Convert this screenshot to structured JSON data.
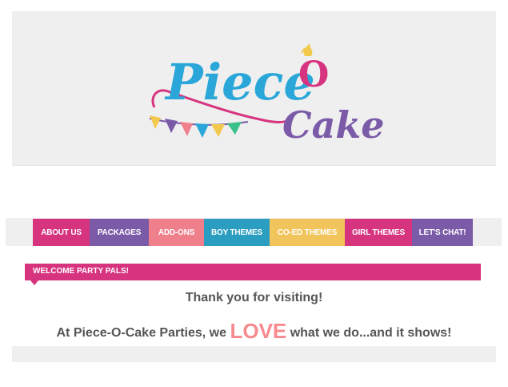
{
  "logo": {
    "line1": "Piece",
    "line1b": "O",
    "line2": "Cake"
  },
  "colors": {
    "brand_blue": "#2aa7d8",
    "brand_purple": "#7b5ba8",
    "brand_pink": "#d6347f",
    "accent_yellow": "#f2c94c",
    "love_coral": "#f78a8f"
  },
  "nav": {
    "items": [
      {
        "label": "ABOUT US",
        "color": "#d6347f"
      },
      {
        "label": "PACKAGES",
        "color": "#7b5ba8"
      },
      {
        "label": "ADD-ONS",
        "color": "#f07f8c"
      },
      {
        "label": "BOY THEMES",
        "color": "#2a9dc0"
      },
      {
        "label": "CO-ED THEMES",
        "color": "#f2c55c"
      },
      {
        "label": "GIRL THEMES",
        "color": "#d6347f"
      },
      {
        "label": "LET'S CHAT!",
        "color": "#7b5ba8"
      }
    ]
  },
  "welcome": {
    "heading": "WELCOME PARTY PALS!"
  },
  "content": {
    "thanks": "Thank you for visiting!",
    "tagline_before": "At Piece-O-Cake Parties, we ",
    "tagline_love": "LOVE",
    "tagline_after": " what we do...and it shows!"
  }
}
